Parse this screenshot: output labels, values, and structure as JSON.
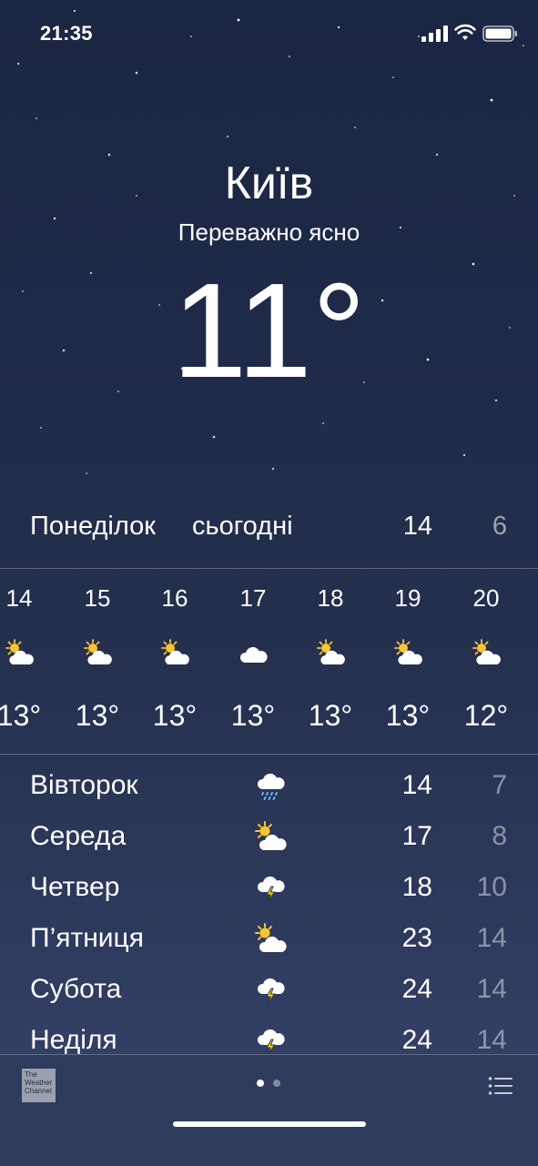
{
  "status_bar": {
    "time": "21:35"
  },
  "location": {
    "city": "Київ",
    "condition": "Переважно ясно",
    "temperature": "11°"
  },
  "today": {
    "day": "Понеділок",
    "label": "сьогодні",
    "high": "14",
    "low": "6"
  },
  "hourly": [
    {
      "hour": "14",
      "icon": "partly-cloudy-icon",
      "temp": "13°"
    },
    {
      "hour": "15",
      "icon": "partly-cloudy-icon",
      "temp": "13°"
    },
    {
      "hour": "16",
      "icon": "partly-cloudy-icon",
      "temp": "13°"
    },
    {
      "hour": "17",
      "icon": "cloud-icon",
      "temp": "13°"
    },
    {
      "hour": "18",
      "icon": "partly-cloudy-icon",
      "temp": "13°"
    },
    {
      "hour": "19",
      "icon": "partly-cloudy-icon",
      "temp": "13°"
    },
    {
      "hour": "20",
      "icon": "partly-cloudy-icon",
      "temp": "12°"
    }
  ],
  "daily": [
    {
      "day": "Вівторок",
      "icon": "rain-icon",
      "high": "14",
      "low": "7"
    },
    {
      "day": "Середа",
      "icon": "partly-cloudy-icon",
      "high": "17",
      "low": "8"
    },
    {
      "day": "Четвер",
      "icon": "thunderstorm-icon",
      "high": "18",
      "low": "10"
    },
    {
      "day": "П’ятниця",
      "icon": "partly-cloudy-icon",
      "high": "23",
      "low": "14"
    },
    {
      "day": "Субота",
      "icon": "thunderstorm-icon",
      "high": "24",
      "low": "14"
    },
    {
      "day": "Неділя",
      "icon": "thunderstorm-icon",
      "high": "24",
      "low": "14"
    }
  ],
  "footer": {
    "provider_logo": "The Weather Channel",
    "page_indicator": {
      "pages": 2,
      "current": 1
    }
  },
  "colors": {
    "sun": "#f7c531",
    "cloud": "#ffffff",
    "rain": "#5ab8f5",
    "bolt": "#f7d200"
  }
}
